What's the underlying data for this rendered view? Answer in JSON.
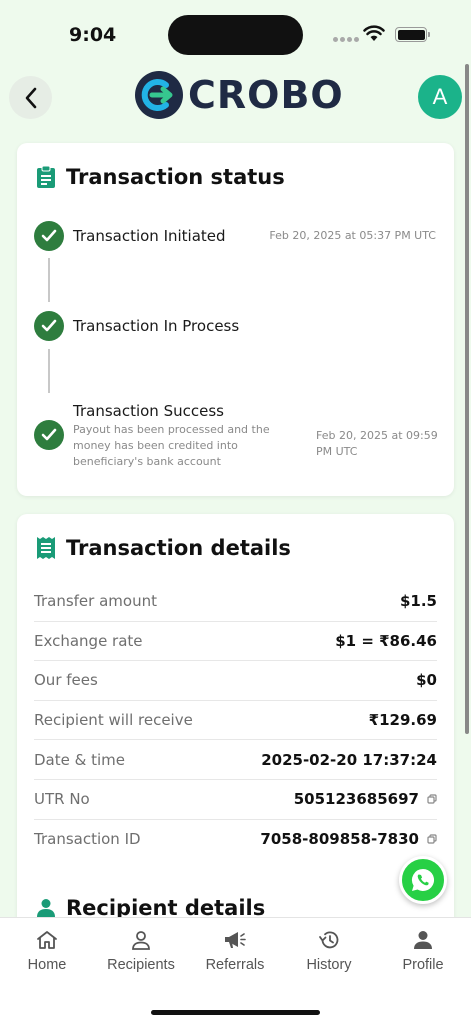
{
  "status_bar": {
    "time": "9:04"
  },
  "header": {
    "brand": "CROBO",
    "avatar_initial": "A"
  },
  "status_card": {
    "title": "Transaction status",
    "steps": [
      {
        "label": "Transaction Initiated",
        "timestamp": "Feb 20, 2025 at 05:37 PM UTC"
      },
      {
        "label": "Transaction In Process"
      },
      {
        "label": "Transaction Success",
        "description": "Payout has been processed and the money has been credited into beneficiary's bank account",
        "timestamp": "Feb 20, 2025 at 09:59 PM UTC"
      }
    ]
  },
  "details_card": {
    "title": "Transaction details",
    "rows": [
      {
        "label": "Transfer amount",
        "value": "$1.5"
      },
      {
        "label": "Exchange rate",
        "value": "$1 = ₹86.46"
      },
      {
        "label": "Our fees",
        "value": "$0"
      },
      {
        "label": "Recipient will receive",
        "value": "₹129.69"
      },
      {
        "label": "Date & time",
        "value": "2025-02-20 17:37:24"
      },
      {
        "label": "UTR No",
        "value": "505123685697"
      },
      {
        "label": "Transaction ID",
        "value": "7058-809858-7830"
      }
    ],
    "recipient_title": "Recipient details"
  },
  "nav": {
    "items": [
      {
        "label": "Home",
        "icon": "home-icon"
      },
      {
        "label": "Recipients",
        "icon": "person-icon"
      },
      {
        "label": "Referrals",
        "icon": "megaphone-icon"
      },
      {
        "label": "History",
        "icon": "history-icon"
      },
      {
        "label": "Profile",
        "icon": "profile-icon"
      }
    ]
  },
  "colors": {
    "accent_green": "#2e7d3e",
    "teal": "#1bb38a",
    "whatsapp": "#27d045",
    "background": "#eefaed"
  }
}
